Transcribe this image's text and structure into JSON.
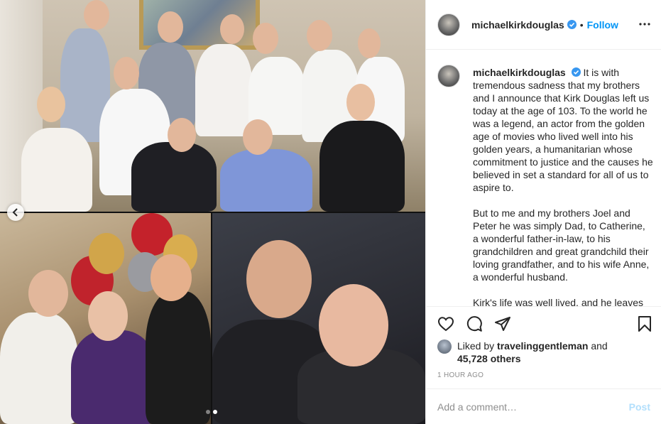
{
  "post": {
    "username": "michaelkirkdouglas",
    "verified": true,
    "separator": "•",
    "follow_label": "Follow",
    "more_icon": "more-horizontal-icon",
    "caption": {
      "username": "michaelkirkdouglas",
      "paragraph_1": "It is with tremendous sadness that my brothers and I announce that Kirk Douglas left us today at the age of 103. To the world he was a legend, an actor from the golden age of movies who lived well into his golden years, a humanitarian whose commitment to justice and the causes he believed in set a standard for all of us to aspire to.",
      "paragraph_2": "But to me and my brothers Joel and Peter he was simply Dad, to Catherine, a wonderful father-in-law, to his grandchildren and great grandchild their loving grandfather, and to his wife Anne, a wonderful husband.",
      "paragraph_3": "Kirk's life was well lived, and he leaves"
    },
    "likes": {
      "prefix": "Liked by",
      "liker": "travelinggentleman",
      "conjunction": "and",
      "others": "45,728 others"
    },
    "timestamp": "1 HOUR AGO",
    "comment_placeholder": "Add a comment…",
    "post_label": "Post"
  },
  "media": {
    "slide_count": 2,
    "active_slide": 2
  },
  "colors": {
    "link_blue": "#0095f6",
    "post_disabled": "#b2dffc",
    "muted_text": "#8e8e8e",
    "verified_blue": "#3897f0"
  }
}
